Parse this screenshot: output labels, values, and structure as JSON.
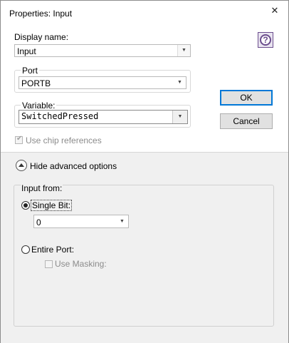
{
  "window": {
    "title": "Properties: Input",
    "close_glyph": "✕"
  },
  "display_name": {
    "label": "Display name:",
    "value": "Input"
  },
  "port": {
    "group_label": "Port",
    "value": "PORTB"
  },
  "variable": {
    "group_label": "Variable:",
    "value": "SwitchedPressed"
  },
  "use_chip_references": {
    "label": "Use chip references",
    "checked": true,
    "enabled": false
  },
  "buttons": {
    "ok": "OK",
    "cancel": "Cancel",
    "help_glyph": "?"
  },
  "advanced": {
    "toggle_label": "Hide advanced options",
    "input_from_label": "Input from:",
    "single_bit": {
      "label": "Single Bit:",
      "selected": true,
      "value": "0"
    },
    "entire_port": {
      "label": "Entire Port:",
      "selected": false
    },
    "use_masking": {
      "label": "Use Masking:",
      "checked": false,
      "enabled": false
    }
  },
  "icons": {
    "close": "close-icon",
    "help": "help-icon",
    "dropdown": "chevron-down-icon",
    "collapse": "collapse-up-icon"
  },
  "colors": {
    "help_accent": "#6a4c8c",
    "default_button_border": "#0078d7",
    "advanced_panel_bg": "#f0f0f0"
  }
}
